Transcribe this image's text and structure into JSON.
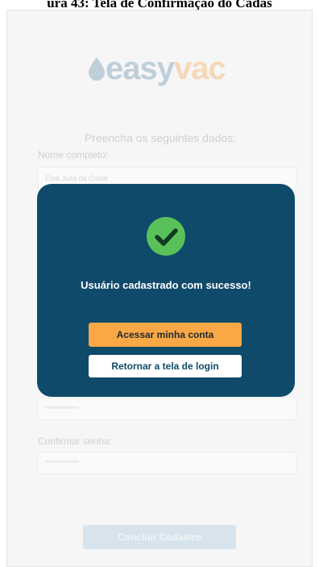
{
  "caption": "ura 43: Tela de Confirmação do Cadas",
  "logo": {
    "part1": "easy",
    "part2": "vac"
  },
  "form": {
    "subtitle": "Preencha os seguintes dados:",
    "name_label": "Nome completo:",
    "name_value": "Eloá Julia da Costa",
    "password_value": "************",
    "confirm_label": "Confirmar senha:",
    "confirm_value": "************",
    "submit_label": "Concluir Cadastro"
  },
  "modal": {
    "message": "Usuário cadastrado com sucesso!",
    "primary_label": "Acessar minha conta",
    "secondary_label": "Retornar a tela de login"
  },
  "icons": {
    "logo": "droplet-icon",
    "success": "check-circle-icon"
  },
  "colors": {
    "modal_bg": "#0f4a6b",
    "primary_button": "#f9a845",
    "success_icon": "#5ac15a",
    "logo_easy": "#7aa0b8",
    "logo_vac": "#f5b16a",
    "submit_button": "#9fc4de"
  }
}
